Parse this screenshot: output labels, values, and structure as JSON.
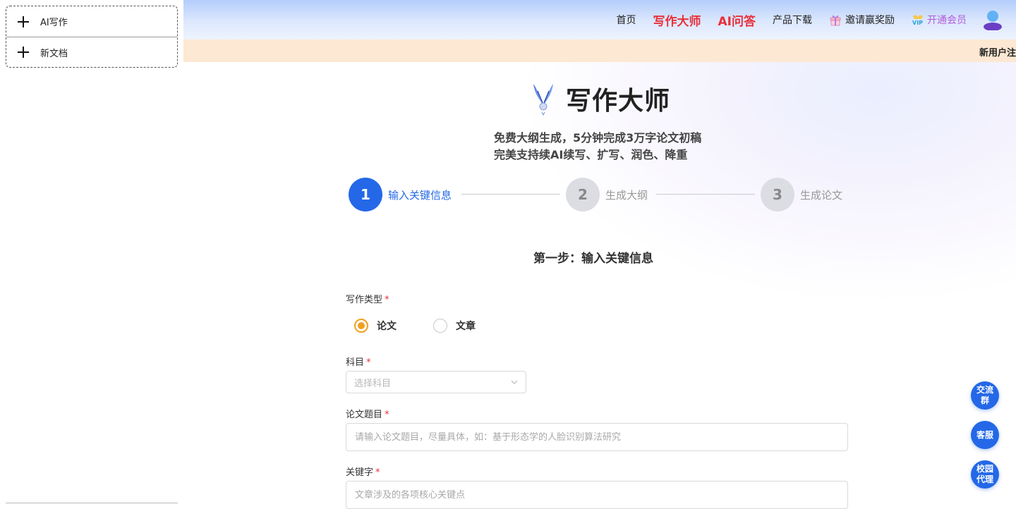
{
  "sidebar": {
    "items": [
      {
        "label": "AI写作",
        "icon": "plus-icon"
      },
      {
        "label": "新文档",
        "icon": "plus-icon"
      }
    ]
  },
  "header": {
    "nav": {
      "home": "首页",
      "writing_master": "写作大师",
      "ai_qa": "AI问答",
      "download": "产品下载",
      "invite": "邀请赢奖励",
      "vip": "开通会员"
    },
    "icons": {
      "invite": "gift-icon",
      "vip": "vip-icon",
      "user": "user-avatar-icon"
    }
  },
  "notice": {
    "text": "新用户注"
  },
  "brand": {
    "title": "写作大师",
    "subtitle_line1": "免费大纲生成，5分钟完成3万字论文初稿",
    "subtitle_line2": "完美支持续AI续写、扩写、润色、降重"
  },
  "steps": [
    {
      "number": "1",
      "label": "输入关键信息",
      "state": "active"
    },
    {
      "number": "2",
      "label": "生成大纲",
      "state": "inactive"
    },
    {
      "number": "3",
      "label": "生成论文",
      "state": "inactive"
    }
  ],
  "form": {
    "section_title": "第一步：输入关键信息",
    "writing_type": {
      "label": "写作类型",
      "required_mark": "*",
      "options": [
        {
          "label": "论文",
          "selected": true
        },
        {
          "label": "文章",
          "selected": false
        }
      ]
    },
    "subject": {
      "label": "科目",
      "required_mark": "*",
      "placeholder": "选择科目"
    },
    "title": {
      "label": "论文题目",
      "required_mark": "*",
      "placeholder": "请输入论文题目，尽量具体，如：基于形态学的人脸识别算法研究"
    },
    "keywords": {
      "label": "关键字",
      "required_mark": "*",
      "placeholder": "文章涉及的各项核心关键点"
    }
  },
  "floating": {
    "group": "交流群",
    "service": "客服",
    "campus": "校园代理"
  },
  "colors": {
    "primary": "#2468e8",
    "accent_red": "#e8303a",
    "radio_selected": "#f0a020",
    "notice_bg": "#fde8d3",
    "vip": "#b25bd9"
  }
}
